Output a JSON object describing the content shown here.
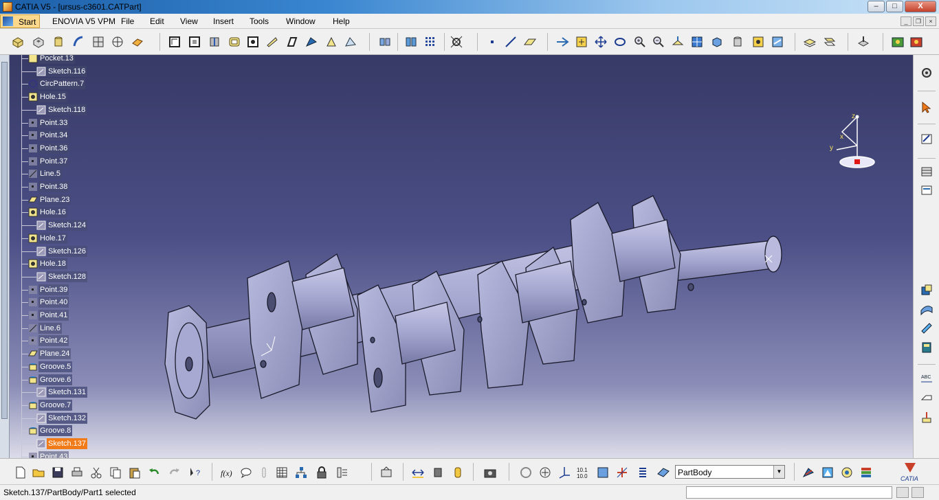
{
  "window": {
    "title": "CATIA V5 - [ursus-c3601.CATPart]",
    "min_label": "–",
    "max_label": "□",
    "close_label": "X"
  },
  "menu": {
    "start": "Start",
    "items": [
      "ENOVIA V5 VPM",
      "File",
      "Edit",
      "View",
      "Insert",
      "Tools",
      "Window",
      "Help"
    ]
  },
  "tree": {
    "nodes": [
      {
        "label": "Pocket.13",
        "icon": "pocket-icon"
      },
      {
        "label": "Sketch.116",
        "icon": "sketch-icon"
      },
      {
        "label": "CircPattern.7",
        "icon": "circpattern-icon"
      },
      {
        "label": "Hole.15",
        "icon": "hole-icon"
      },
      {
        "label": "Sketch.118",
        "icon": "sketch-icon"
      },
      {
        "label": "Point.33",
        "icon": "point-icon"
      },
      {
        "label": "Point.34",
        "icon": "point-icon"
      },
      {
        "label": "Point.36",
        "icon": "point-icon"
      },
      {
        "label": "Point.37",
        "icon": "point-icon"
      },
      {
        "label": "Line.5",
        "icon": "line-icon"
      },
      {
        "label": "Point.38",
        "icon": "point-icon"
      },
      {
        "label": "Plane.23",
        "icon": "plane-icon"
      },
      {
        "label": "Hole.16",
        "icon": "hole-icon"
      },
      {
        "label": "Sketch.124",
        "icon": "sketch-icon"
      },
      {
        "label": "Hole.17",
        "icon": "hole-icon"
      },
      {
        "label": "Sketch.126",
        "icon": "sketch-icon"
      },
      {
        "label": "Hole.18",
        "icon": "hole-icon"
      },
      {
        "label": "Sketch.128",
        "icon": "sketch-icon"
      },
      {
        "label": "Point.39",
        "icon": "point-icon"
      },
      {
        "label": "Point.40",
        "icon": "point-icon"
      },
      {
        "label": "Point.41",
        "icon": "point-icon"
      },
      {
        "label": "Line.6",
        "icon": "line-icon"
      },
      {
        "label": "Point.42",
        "icon": "point-icon"
      },
      {
        "label": "Plane.24",
        "icon": "plane-icon"
      },
      {
        "label": "Groove.5",
        "icon": "groove-icon"
      },
      {
        "label": "Groove.6",
        "icon": "groove-icon"
      },
      {
        "label": "Sketch.131",
        "icon": "sketch-icon"
      },
      {
        "label": "Groove.7",
        "icon": "groove-icon"
      },
      {
        "label": "Sketch.132",
        "icon": "sketch-icon"
      },
      {
        "label": "Groove.8",
        "icon": "groove-icon"
      },
      {
        "label": "Sketch.137",
        "icon": "sketch-icon",
        "selected": true
      },
      {
        "label": "Point.43",
        "icon": "point-icon"
      }
    ]
  },
  "bottom": {
    "body_selector": "PartBody"
  },
  "status": {
    "text": "Sketch.137/PartBody/Part1 selected"
  },
  "logo": {
    "text": "CATIA"
  },
  "compass": {
    "x_label": "x",
    "y_label": "y",
    "z_label": "z"
  },
  "axis_small": {
    "x_label": "x",
    "y_label": "y",
    "z_label": "z"
  },
  "colors": {
    "viewport_top": "#373a66",
    "viewport_bottom": "#dcdce9",
    "part": "#9d9ec9",
    "selection": "#f07b18"
  }
}
